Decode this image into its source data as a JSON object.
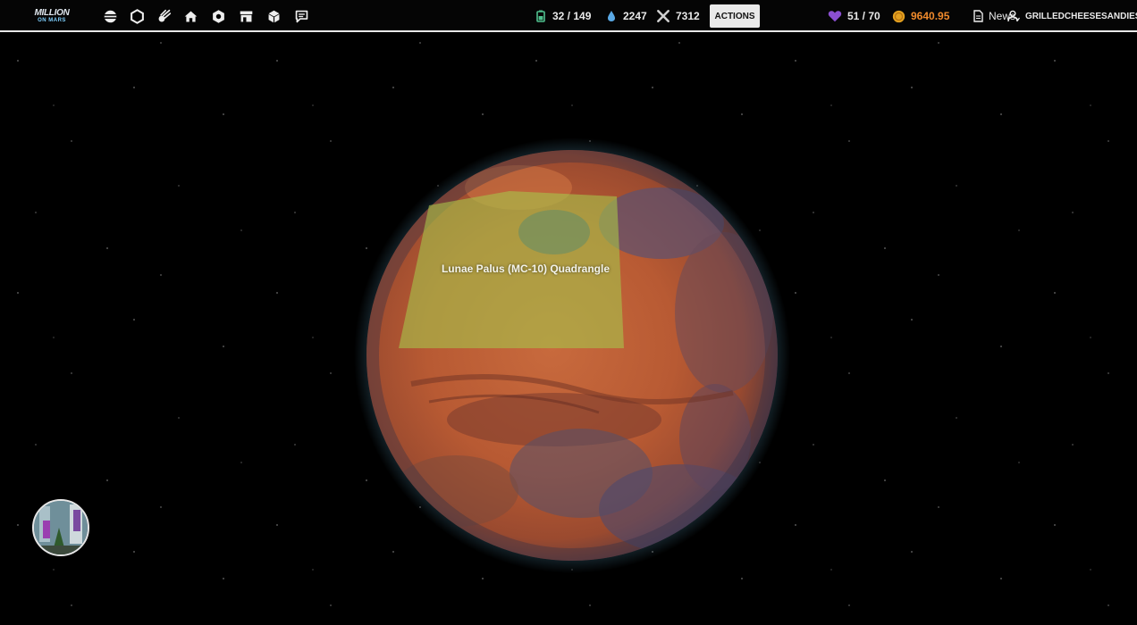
{
  "logo": {
    "line1": "MILLION",
    "line2": "ON MARS"
  },
  "nav": [
    {
      "name": "research-icon"
    },
    {
      "name": "hexagon-icon"
    },
    {
      "name": "meteor-icon"
    },
    {
      "name": "home-icon"
    },
    {
      "name": "module-icon"
    },
    {
      "name": "store-icon"
    },
    {
      "name": "cube-icon"
    },
    {
      "name": "chat-icon"
    }
  ],
  "stats": {
    "energy": "32 / 149",
    "water": "2247",
    "tools": "7312",
    "health": "51 / 70",
    "coins": "9640.95"
  },
  "actions_label": "ACTIONS",
  "news_label": "News",
  "username": "GRILLEDCHEESESANDIES",
  "region_label": "Lunae Palus (MC-10) Quadrangle",
  "colors": {
    "accent_orange": "#f08a2c",
    "energy_green": "#4fc08d",
    "water_blue": "#5aa9e6",
    "health_purple": "#8b4fd1",
    "coin_gold": "#e3a020",
    "region_overlay": "#a7c24a"
  }
}
